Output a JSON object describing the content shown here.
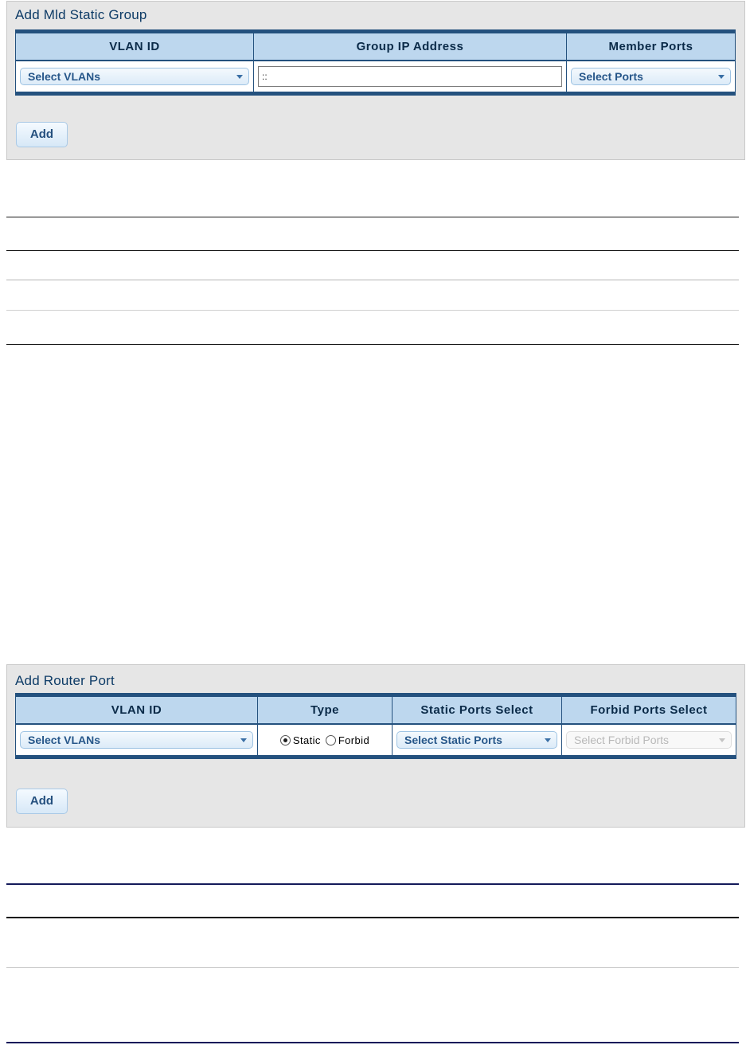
{
  "mld_static_group": {
    "title": "Add Mld Static Group",
    "columns": [
      "VLAN ID",
      "Group IP Address",
      "Member Ports"
    ],
    "vlan_select": "Select VLANs",
    "group_ip_value": "::",
    "member_ports_select": "Select Ports",
    "add_label": "Add"
  },
  "router_port": {
    "title": "Add Router Port",
    "columns": [
      "VLAN ID",
      "Type",
      "Static Ports Select",
      "Forbid Ports Select"
    ],
    "vlan_select": "Select VLANs",
    "type_options": [
      "Static",
      "Forbid"
    ],
    "type_selected": "Static",
    "static_ports_select": "Select Static Ports",
    "forbid_ports_select": "Select Forbid Ports",
    "add_label": "Add"
  },
  "colors": {
    "panel_bg": "#e6e6e6",
    "table_border": "#24517e",
    "header_bg": "#bdd7ee",
    "title_text": "#0d3b66",
    "accent_text": "#27578a"
  }
}
